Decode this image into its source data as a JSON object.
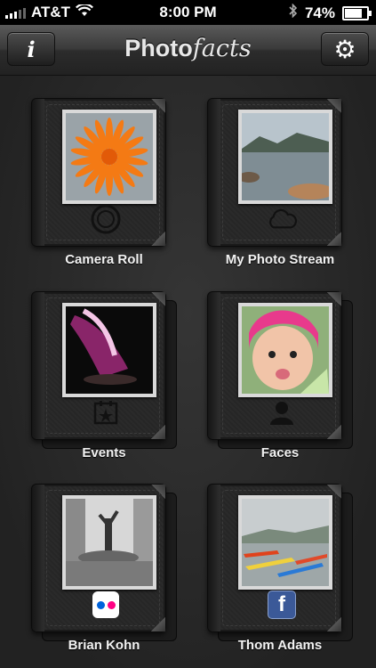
{
  "status": {
    "carrier": "AT&T",
    "time": "8:00 PM",
    "battery": "74%",
    "battery_level": 0.74
  },
  "nav": {
    "title_a": "Photo",
    "title_b": "facts",
    "info_label": "i"
  },
  "albums": [
    {
      "label": "Camera Roll",
      "badge": "camera-shutter-icon"
    },
    {
      "label": "My Photo Stream",
      "badge": "cloud-icon"
    },
    {
      "label": "Events",
      "badge": "calendar-star-icon"
    },
    {
      "label": "Faces",
      "badge": "person-silhouette-icon"
    },
    {
      "label": "Brian Kohn",
      "badge": "flickr-icon"
    },
    {
      "label": "Thom Adams",
      "badge": "facebook-icon",
      "badge_text": "f"
    }
  ],
  "colors": {
    "flickr_blue": "#0063dc",
    "flickr_pink": "#ff0084",
    "facebook_blue": "#3b5998"
  }
}
